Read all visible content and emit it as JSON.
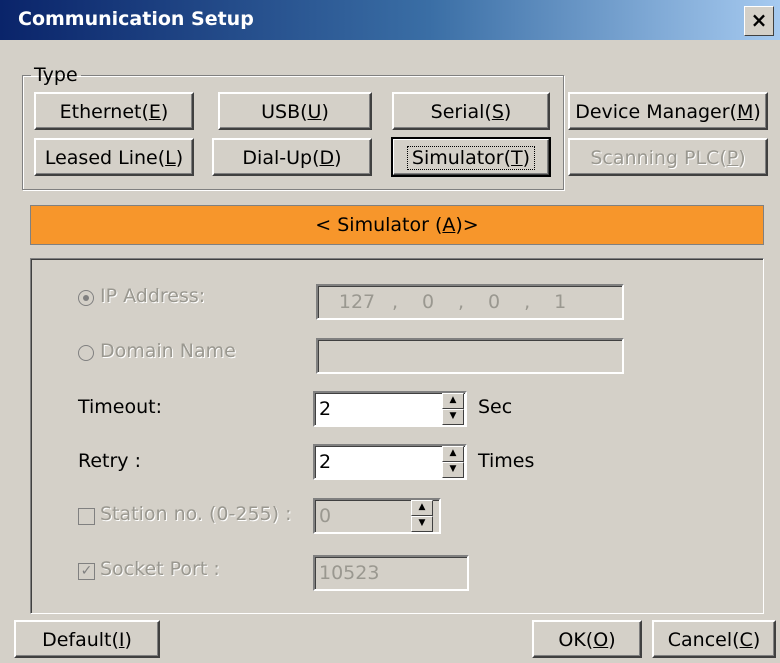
{
  "window": {
    "title": "Communication Setup",
    "close_glyph": "×"
  },
  "type_group": {
    "legend": "Type",
    "buttons": [
      {
        "pre": "Ethernet(",
        "key": "E",
        "post": ")",
        "disabled": false
      },
      {
        "pre": "USB(",
        "key": "U",
        "post": ")",
        "disabled": false
      },
      {
        "pre": "Serial(",
        "key": "S",
        "post": ")",
        "disabled": false
      },
      {
        "pre": "Device Manager(",
        "key": "M",
        "post": ")",
        "disabled": false
      },
      {
        "pre": "Leased Line(",
        "key": "L",
        "post": ")",
        "disabled": false
      },
      {
        "pre": "Dial-Up(",
        "key": "D",
        "post": ")",
        "disabled": false
      },
      {
        "pre": "Simulator(",
        "key": "T",
        "post": ")",
        "disabled": false,
        "focused": true
      },
      {
        "pre": "Scanning PLC(",
        "key": "P",
        "post": ")",
        "disabled": true
      }
    ]
  },
  "banner": {
    "pre": "< Simulator (",
    "key": "A",
    "post": ")>",
    "color": "#f7962b"
  },
  "settings": {
    "ip_label": "IP Address:",
    "ip_octets": [
      "127",
      "0",
      "0",
      "1"
    ],
    "ip_separator": ",",
    "domain_label": "Domain Name",
    "domain_value": "",
    "timeout_label": "Timeout:",
    "timeout_value": "2",
    "timeout_unit": "Sec",
    "retry_label": "Retry :",
    "retry_value": "2",
    "retry_unit": "Times",
    "station_label": "Station no. (0-255) :",
    "station_value": "0",
    "socket_label": "Socket Port :",
    "socket_value": "10523",
    "check_glyph": "✓",
    "spin_up": "▲",
    "spin_down": "▼"
  },
  "footer": {
    "default": {
      "pre": "Default(",
      "key": "I",
      "post": ")"
    },
    "ok": {
      "pre": "OK(",
      "key": "O",
      "post": ")"
    },
    "cancel": {
      "pre": "Cancel(",
      "key": "C",
      "post": ")"
    }
  }
}
